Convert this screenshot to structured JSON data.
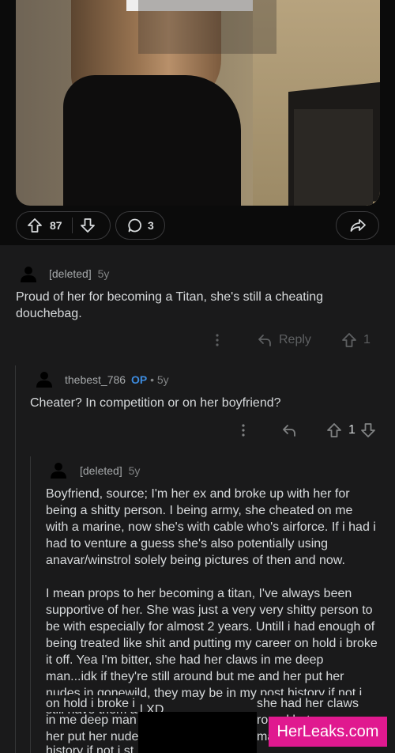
{
  "post": {
    "upvotes": "87",
    "comments": "3"
  },
  "comments": [
    {
      "author": "[deleted]",
      "age": "5y",
      "body": "Proud of her for becoming a Titan, she's still a cheating douchebag.",
      "reply_label": "Reply",
      "score": "1"
    },
    {
      "author": "thebest_786",
      "op_badge": "OP",
      "dot": "•",
      "age": "5y",
      "body": "Cheater? In competition or on her boyfriend?",
      "score": "1"
    },
    {
      "author": "[deleted]",
      "age": "5y",
      "paragraphs": [
        "Boyfriend, source; I'm her ex and broke up with her for being a shitty person. I being army, she cheated on me with a marine, now she's with cable who's airforce. If i had i had to venture a guess she's also potentially using anavar/winstrol solely being pictures of then and now.",
        "I mean props to her becoming a titan,  I've always been supportive of her. She was just a very very shitty person to be with especially for almost 2 years. Untill i had enough of being treated like shit and putting my career on hold i broke it off. Yea I'm bitter, she had her claws in me deep man...idk if they're still around but me and her put her nudes in gonewild, they may be in my post history if not i still have them all XD"
      ],
      "duplicated_fragments": {
        "line1_left": "on hold i broke i",
        "line1_right": "she had her claws",
        "line2_left": "in me deep man",
        "line2_right": "round but me and",
        "line3_left": "her put her nude",
        "line3_right": "ma",
        "line4_left": "history if not i st"
      }
    }
  ],
  "watermark": "HerLeaks.com",
  "colors": {
    "background": "#0b0b0b",
    "comment_bg": "#1a1a1b",
    "op_blue": "#3d8ce0",
    "watermark_pink": "#e0198f"
  }
}
